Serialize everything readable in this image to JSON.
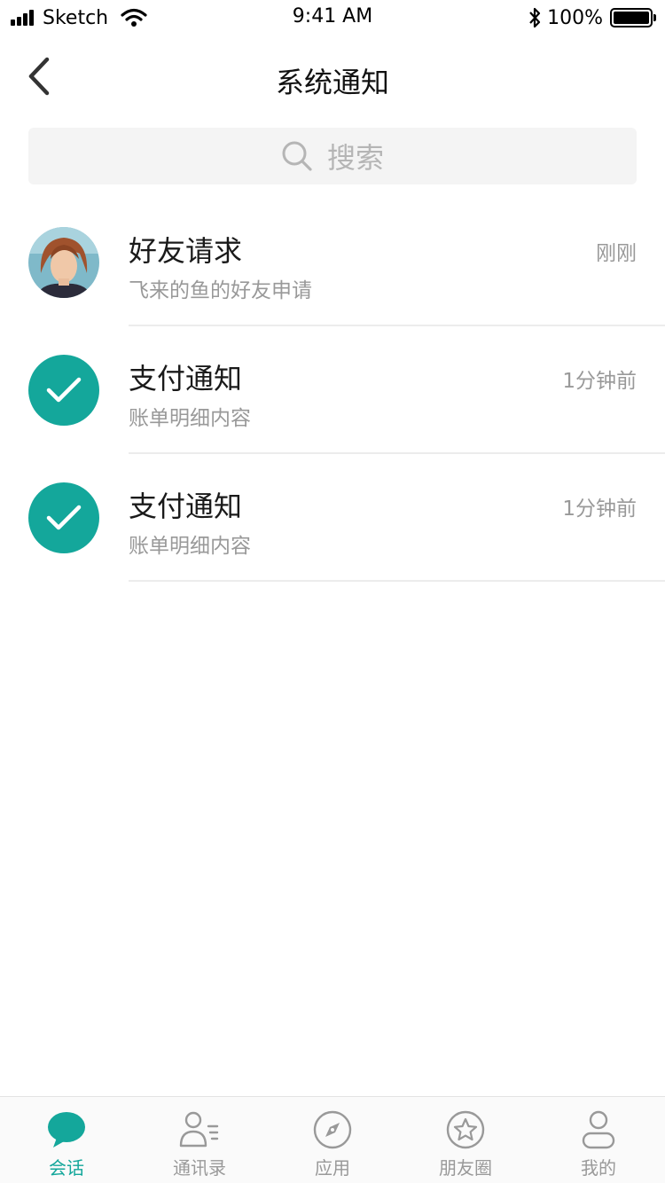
{
  "status_bar": {
    "carrier": "Sketch",
    "time": "9:41 AM",
    "battery_percent": "100%"
  },
  "nav": {
    "title": "系统通知",
    "back_icon": "chevron-left-icon"
  },
  "search": {
    "placeholder": "搜索",
    "icon": "search-icon"
  },
  "notifications": [
    {
      "title": "好友请求",
      "subtitle": "飞来的鱼的好友申请",
      "time": "刚刚",
      "avatar": "user-photo"
    },
    {
      "title": "支付通知",
      "subtitle": "账单明细内容",
      "time": "1分钟前",
      "avatar": "check-icon"
    },
    {
      "title": "支付通知",
      "subtitle": "账单明细内容",
      "time": "1分钟前",
      "avatar": "check-icon"
    }
  ],
  "tabs": [
    {
      "label": "会话",
      "icon": "chat-bubble-icon",
      "active": true
    },
    {
      "label": "通讯录",
      "icon": "contacts-icon",
      "active": false
    },
    {
      "label": "应用",
      "icon": "compass-icon",
      "active": false
    },
    {
      "label": "朋友圈",
      "icon": "star-circle-icon",
      "active": false
    },
    {
      "label": "我的",
      "icon": "profile-icon",
      "active": false
    }
  ],
  "colors": {
    "accent": "#14a79b",
    "muted_text": "#999999",
    "search_bg": "#f4f4f4"
  }
}
